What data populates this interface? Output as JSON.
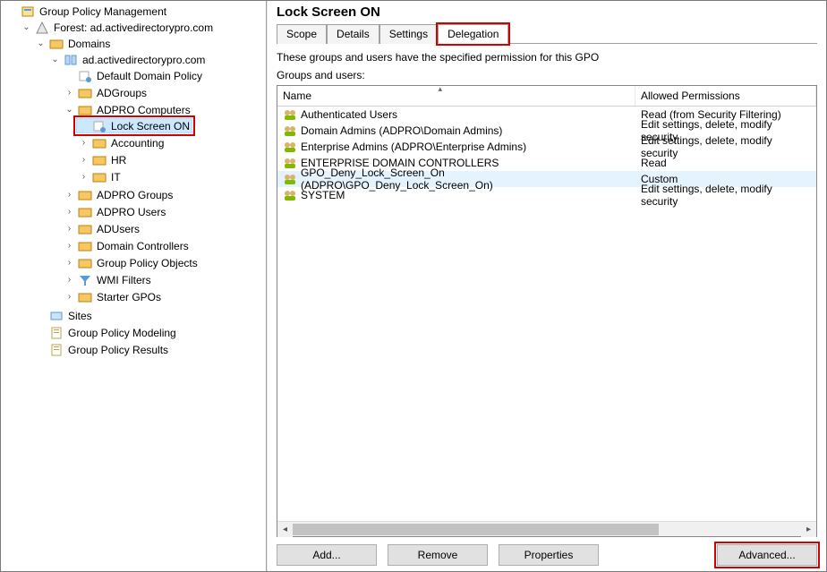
{
  "tree": {
    "root": "Group Policy Management",
    "forest": "Forest: ad.activedirectorypro.com",
    "domains": "Domains",
    "domain": "ad.activedirectorypro.com",
    "ddp": "Default Domain Policy",
    "adgroups": "ADGroups",
    "adpro_computers": "ADPRO Computers",
    "lock_screen_on": "Lock Screen ON",
    "accounting": "Accounting",
    "hr": "HR",
    "it": "IT",
    "adpro_groups": "ADPRO Groups",
    "adpro_users": "ADPRO Users",
    "adusers": "ADUsers",
    "domain_controllers": "Domain Controllers",
    "gpo_objects": "Group Policy Objects",
    "wmi_filters": "WMI Filters",
    "starter_gpos": "Starter GPOs",
    "sites": "Sites",
    "gp_modeling": "Group Policy Modeling",
    "gp_results": "Group Policy Results"
  },
  "panel": {
    "title": "Lock Screen ON",
    "tabs": {
      "scope": "Scope",
      "details": "Details",
      "settings": "Settings",
      "delegation": "Delegation"
    },
    "desc": "These groups and users have the specified permission for this GPO",
    "sublabel": "Groups and users:",
    "columns": {
      "name": "Name",
      "perm": "Allowed Permissions"
    },
    "rows": [
      {
        "name": "Authenticated Users",
        "perm": "Read (from Security Filtering)"
      },
      {
        "name": "Domain Admins (ADPRO\\Domain Admins)",
        "perm": "Edit settings, delete, modify security"
      },
      {
        "name": "Enterprise Admins (ADPRO\\Enterprise Admins)",
        "perm": "Edit settings, delete, modify security"
      },
      {
        "name": "ENTERPRISE DOMAIN CONTROLLERS",
        "perm": "Read"
      },
      {
        "name": "GPO_Deny_Lock_Screen_On (ADPRO\\GPO_Deny_Lock_Screen_On)",
        "perm": "Custom",
        "selected": true
      },
      {
        "name": "SYSTEM",
        "perm": "Edit settings, delete, modify security"
      }
    ],
    "buttons": {
      "add": "Add...",
      "remove": "Remove",
      "properties": "Properties",
      "advanced": "Advanced..."
    }
  }
}
